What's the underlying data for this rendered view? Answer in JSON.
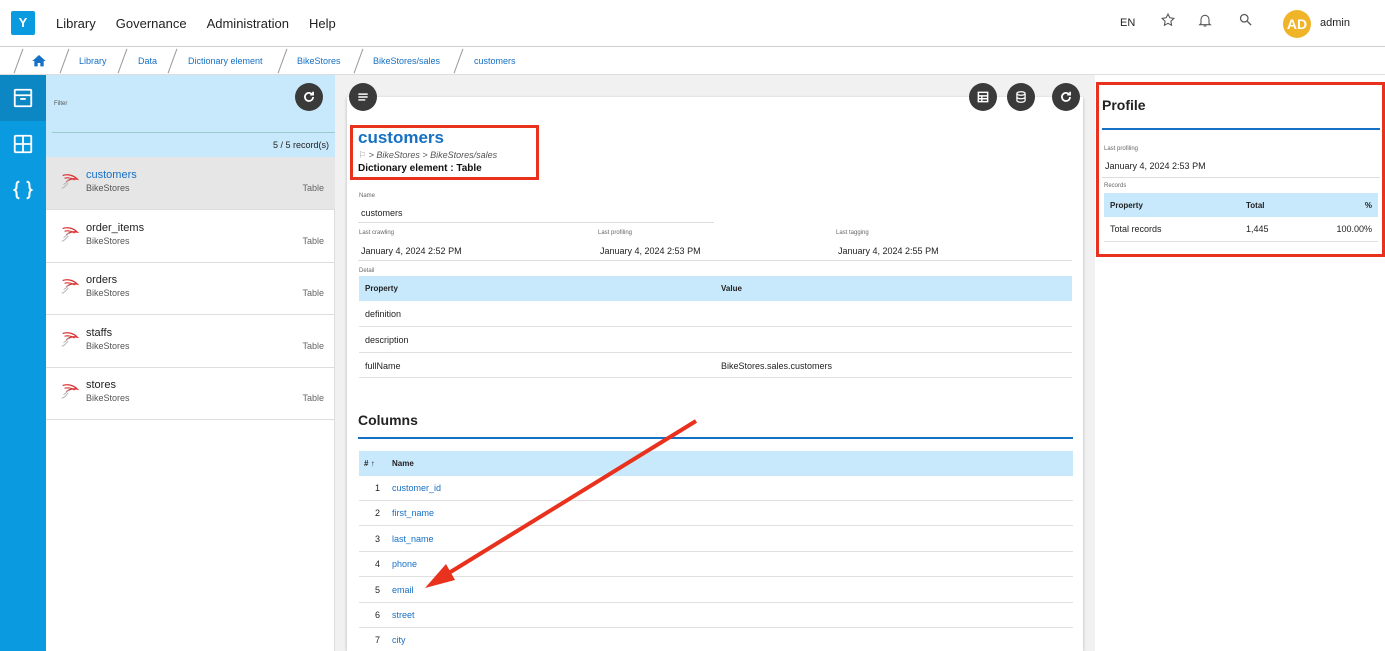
{
  "app": {
    "logo": "Y"
  },
  "topbar": {
    "menu": [
      "Library",
      "Governance",
      "Administration",
      "Help"
    ],
    "lang": "EN",
    "avatar_initials": "AD",
    "username": "admin"
  },
  "breadcrumb": [
    "Library",
    "Data",
    "Dictionary element",
    "BikeStores",
    "BikeStores/sales",
    "customers"
  ],
  "list": {
    "filter_label": "Filter",
    "count": "5 / 5 record(s)",
    "items": [
      {
        "name": "customers",
        "sub": "BikeStores",
        "type": "Table"
      },
      {
        "name": "order_items",
        "sub": "BikeStores",
        "type": "Table"
      },
      {
        "name": "orders",
        "sub": "BikeStores",
        "type": "Table"
      },
      {
        "name": "staffs",
        "sub": "BikeStores",
        "type": "Table"
      },
      {
        "name": "stores",
        "sub": "BikeStores",
        "type": "Table"
      }
    ]
  },
  "entity": {
    "title": "customers",
    "path": "> BikeStores > BikeStores/sales",
    "kind": "Dictionary element : Table",
    "name_label": "Name",
    "name_value": "customers",
    "last_crawling_label": "Last crawling",
    "last_crawling": "January 4, 2024 2:52 PM",
    "last_profiling_label": "Last profiling",
    "last_profiling": "January 4, 2024 2:53 PM",
    "last_tagging_label": "Last tagging",
    "last_tagging": "January 4, 2024 2:55 PM",
    "detail_label": "Detail",
    "detail_headers": [
      "Property",
      "Value"
    ],
    "detail_rows": [
      [
        "definition",
        ""
      ],
      [
        "description",
        ""
      ],
      [
        "fullName",
        "BikeStores.sales.customers"
      ]
    ]
  },
  "columns": {
    "title": "Columns",
    "headers": [
      "#",
      "Name"
    ],
    "rows": [
      [
        "1",
        "customer_id"
      ],
      [
        "2",
        "first_name"
      ],
      [
        "3",
        "last_name"
      ],
      [
        "4",
        "phone"
      ],
      [
        "5",
        "email"
      ],
      [
        "6",
        "street"
      ],
      [
        "7",
        "city"
      ]
    ]
  },
  "profile": {
    "title": "Profile",
    "last_profiling_label": "Last profiling",
    "last_profiling": "January 4, 2024 2:53 PM",
    "records_label": "Records",
    "headers": [
      "Property",
      "Total",
      "%"
    ],
    "row": [
      "Total records",
      "1,445",
      "100.00%"
    ]
  },
  "colors": {
    "accent": "#0a9ae0",
    "link": "#1670c4",
    "highlight": "#e8321e",
    "table_header": "#c8e8fb"
  }
}
